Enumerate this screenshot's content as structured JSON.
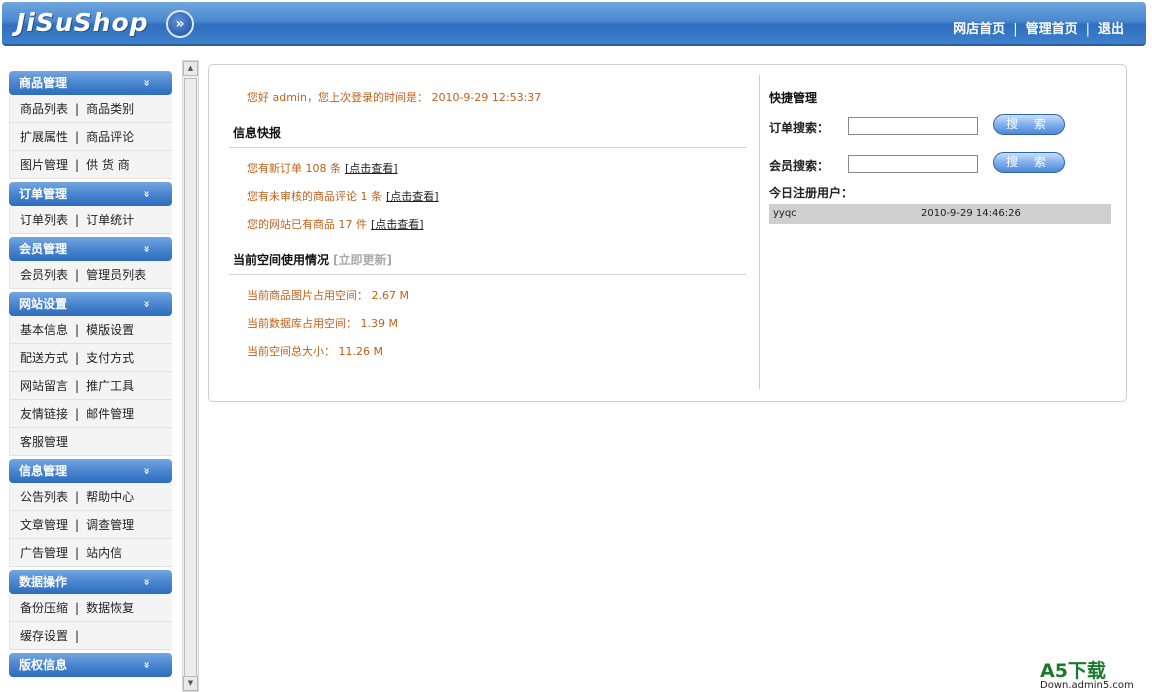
{
  "header": {
    "logo": "JiSuShop",
    "toggle_icon": "»",
    "links": [
      "网店首页",
      "管理首页",
      "退出"
    ],
    "separator": "|"
  },
  "sidebar": {
    "chevron": "»",
    "sections": [
      {
        "title": "商品管理",
        "rows": [
          [
            "商品列表",
            "商品类别"
          ],
          [
            "扩展属性",
            "商品评论"
          ],
          [
            "图片管理",
            "供 货 商"
          ]
        ]
      },
      {
        "title": "订单管理",
        "rows": [
          [
            "订单列表",
            "订单统计"
          ]
        ]
      },
      {
        "title": "会员管理",
        "rows": [
          [
            "会员列表",
            "管理员列表"
          ]
        ]
      },
      {
        "title": "网站设置",
        "rows": [
          [
            "基本信息",
            "模版设置"
          ],
          [
            "配送方式",
            "支付方式"
          ],
          [
            "网站留言",
            "推广工具"
          ],
          [
            "友情链接",
            "邮件管理"
          ],
          [
            "客服管理"
          ]
        ]
      },
      {
        "title": "信息管理",
        "rows": [
          [
            "公告列表",
            "帮助中心"
          ],
          [
            "文章管理",
            "调查管理"
          ],
          [
            "广告管理",
            "站内信"
          ]
        ]
      },
      {
        "title": "数据操作",
        "rows": [
          [
            "备份压缩",
            "数据恢复"
          ],
          [
            "缓存设置",
            ""
          ]
        ]
      },
      {
        "title": "版权信息",
        "rows": []
      }
    ]
  },
  "main": {
    "welcome": "您好 admin，您上次登录的时间是： 2010-9-29 12:53:37",
    "news_title": "信息快报",
    "news": [
      {
        "text": "您有新订单 108 条",
        "link": "[点击查看]"
      },
      {
        "text": "您有未审核的商品评论 1 条",
        "link": "[点击查看]"
      },
      {
        "text": "您的网站已有商品 17 件",
        "link": "[点击查看]"
      }
    ],
    "space_title": "当前空间使用情况",
    "space_update": "[立即更新]",
    "space": [
      "当前商品图片占用空间： 2.67 M",
      "当前数据库占用空间： 1.39 M",
      "当前空间总大小： 11.26 M"
    ]
  },
  "quick": {
    "title": "快捷管理",
    "order_label": "订单搜索：",
    "member_label": "会员搜索：",
    "search_button": "搜 索",
    "reg_title": "今日注册用户：",
    "reg_users": [
      {
        "name": "yyqc",
        "time": "2010-9-29 14:46:26"
      }
    ]
  },
  "watermark": {
    "big": "A5下载",
    "small": "Down.admin5.com"
  }
}
